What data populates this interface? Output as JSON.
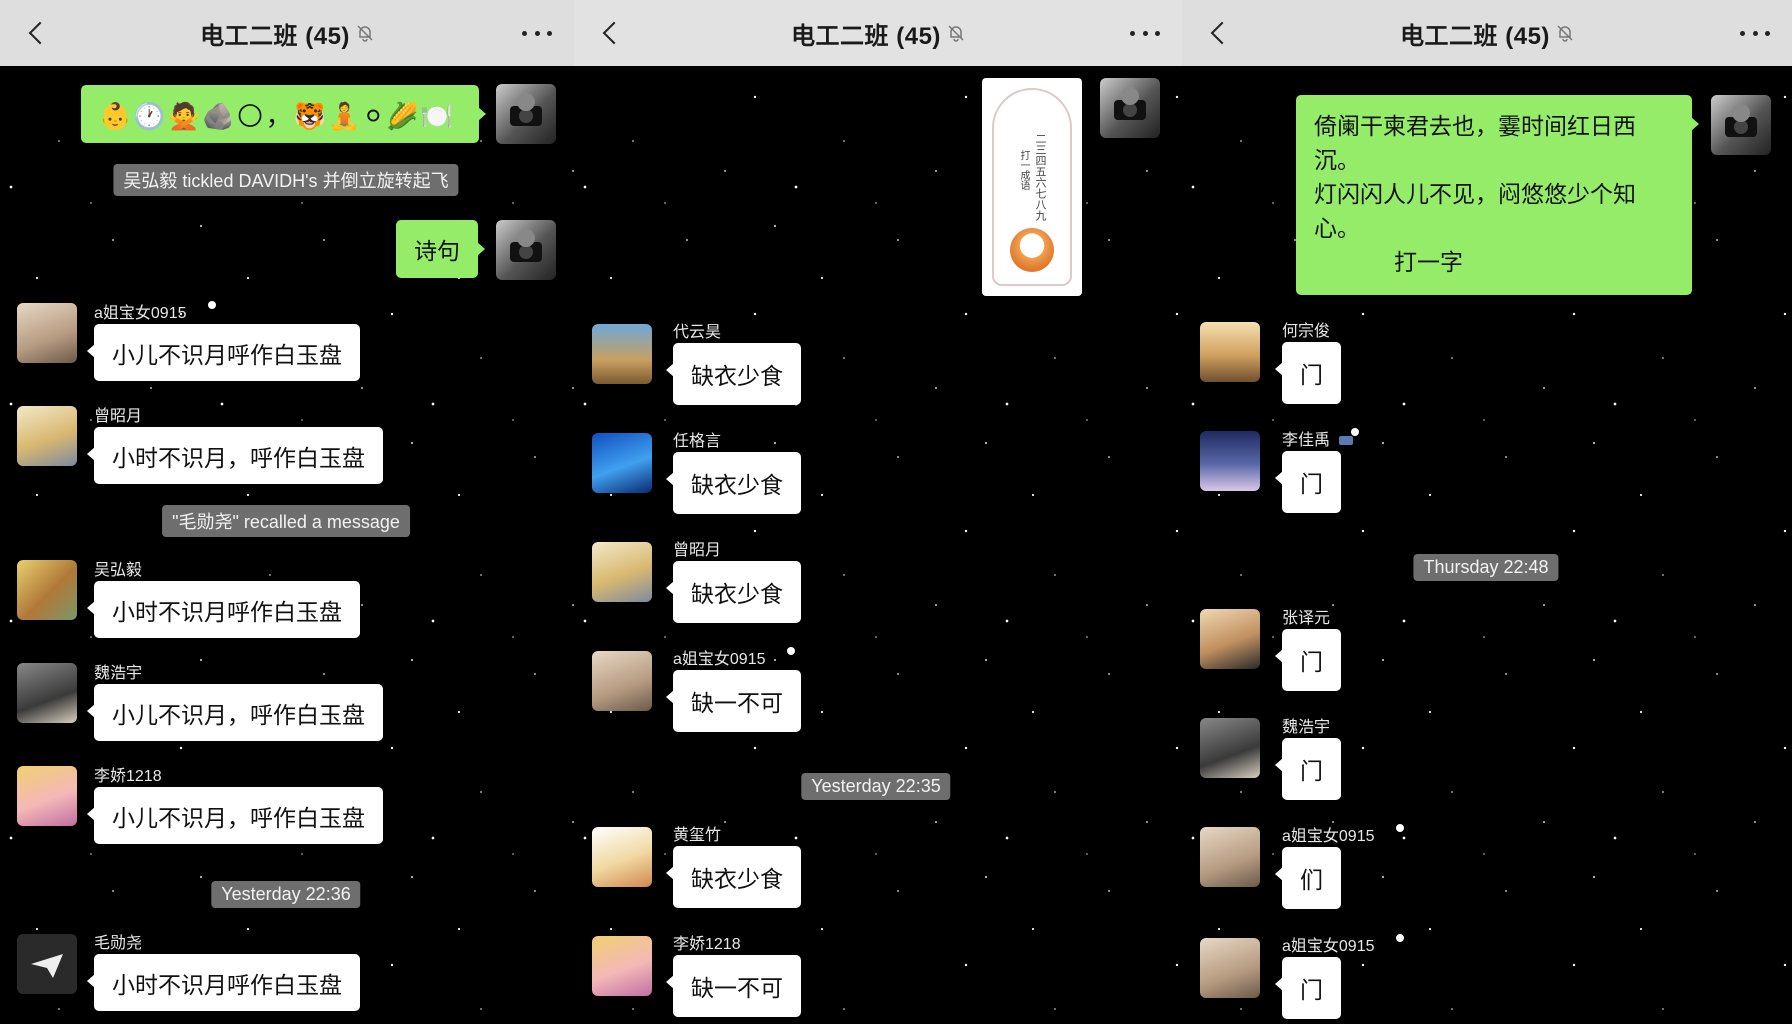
{
  "chat_title": "电工二班 (45)",
  "colors": {
    "navbar": "#dedede",
    "my_bubble": "#95ec69",
    "bubble": "#ffffff",
    "system": "#6e6e6e"
  },
  "panel1": {
    "emoji_message": "👶🕐🙅🪨🌕，🐯🧘⚪🌽🍽️",
    "sys_tickle": "吴弘毅 tickled DAVIDH's 并倒立旋转起飞",
    "my_text": "诗句",
    "messages": [
      {
        "name": "a姐宝女0915",
        "text": "小儿不识月呼作白玉盘"
      },
      {
        "name": "曾昭月",
        "text": "小时不识月，呼作白玉盘"
      },
      {
        "name": "吴弘毅",
        "text": "小时不识月呼作白玉盘"
      },
      {
        "name": "魏浩宇",
        "text": "小儿不识月，呼作白玉盘"
      },
      {
        "name": "李娇1218",
        "text": "小儿不识月，呼作白玉盘"
      },
      {
        "name": "毛勋尧",
        "text": "小时不识月呼作白玉盘"
      }
    ],
    "sys_recall": "\"毛勋尧\" recalled a message",
    "time_sep": "Yesterday 22:36"
  },
  "panel2": {
    "card_line1": "二三四五六七八九",
    "card_line2": "打一成语",
    "messages": [
      {
        "name": "代云昊",
        "text": "缺衣少食"
      },
      {
        "name": "任格言",
        "text": "缺衣少食"
      },
      {
        "name": "曾昭月",
        "text": "缺衣少食"
      },
      {
        "name": "a姐宝女0915",
        "text": "缺一不可"
      },
      {
        "name": "黄玺竹",
        "text": "缺衣少食"
      },
      {
        "name": "李娇1218",
        "text": "缺一不可"
      }
    ],
    "time_sep": "Yesterday 22:35"
  },
  "panel3": {
    "riddle_l1": "倚阑干柬君去也，霎时间红日西",
    "riddle_l2": "沉。",
    "riddle_l3": "灯闪闪人儿不见，闷悠悠少个知",
    "riddle_l4": "心。",
    "riddle_l5": "打一字",
    "messages": [
      {
        "name": "何宗俊",
        "text": "门"
      },
      {
        "name": "李佳禹",
        "text": "门"
      },
      {
        "name": "张译元",
        "text": "门"
      },
      {
        "name": "魏浩宇",
        "text": "门"
      },
      {
        "name": "a姐宝女0915",
        "text": "们"
      },
      {
        "name": "a姐宝女0915",
        "text": "门"
      }
    ],
    "time_sep": "Thursday 22:48"
  }
}
